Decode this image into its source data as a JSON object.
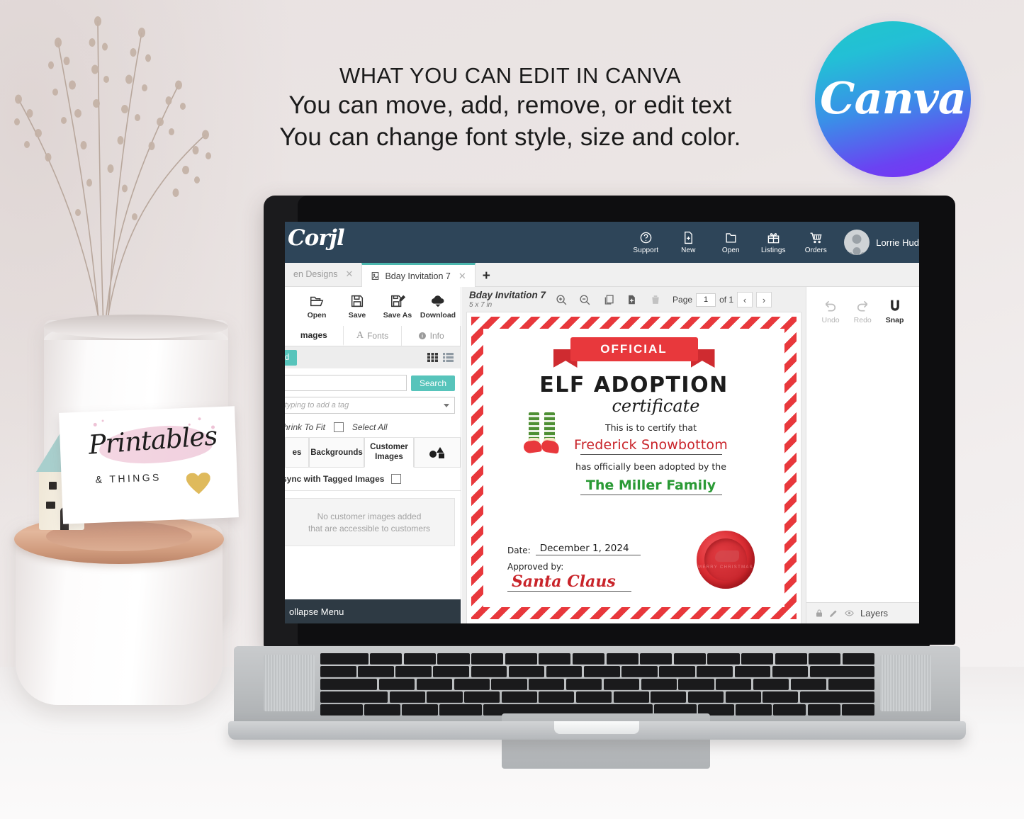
{
  "headline": {
    "line1": "WHAT YOU CAN EDIT IN CANVA",
    "line2": "You can move, add, remove, or edit text",
    "line3": "You can change font style, size and color."
  },
  "canva_badge": {
    "label": "Canva",
    "gradient_from": "#20c7c9",
    "gradient_to": "#7d2ff5"
  },
  "shop_card": {
    "title": "Printables",
    "subtitle": "& THINGS",
    "heart_color": "#dcb34a",
    "blob_color": "#f2cfdd"
  },
  "app": {
    "brand": "Corjl",
    "topbar_color": "#2e4559",
    "accent_color": "#57c4bb",
    "topnav": [
      {
        "label": "Support",
        "icon": "question-circle-icon"
      },
      {
        "label": "New",
        "icon": "new-file-icon"
      },
      {
        "label": "Open",
        "icon": "folder-icon"
      },
      {
        "label": "Listings",
        "icon": "gift-icon"
      },
      {
        "label": "Orders",
        "icon": "cart-icon"
      }
    ],
    "user": {
      "name": "Lorrie Hud"
    },
    "tabs": [
      {
        "label": "en Designs",
        "active": false,
        "closable": true
      },
      {
        "label": "Bday Invitation 7",
        "active": true,
        "closable": true
      }
    ],
    "new_tab_label": "+",
    "left_panel": {
      "tools": [
        {
          "label": "Open",
          "icon": "folder-open-icon"
        },
        {
          "label": "Save",
          "icon": "floppy-disk-icon"
        },
        {
          "label": "Save As",
          "icon": "floppy-disk-pencil-icon"
        },
        {
          "label": "Download",
          "icon": "cloud-download-icon"
        }
      ],
      "tabs": [
        {
          "label": "mages",
          "active": true
        },
        {
          "label": "Fonts",
          "icon": "letter-a-icon",
          "active": false
        },
        {
          "label": "Info",
          "icon": "info-circle-icon",
          "active": false
        }
      ],
      "upload_button": "oad",
      "view_grid_icon": "grid-view-icon",
      "view_list_icon": "list-view-icon",
      "search_value": "",
      "search_placeholder": "",
      "search_button": "Search",
      "tag_placeholder": "gin typing to add a tag",
      "shrink_to_fit_label": "Shrink To Fit",
      "select_all_label": "Select All",
      "category_tabs": [
        {
          "label": "es",
          "active": false
        },
        {
          "label": "Backgrounds",
          "active": false
        },
        {
          "label": "Customer Images",
          "active": true
        },
        {
          "label": "shapes-icon",
          "active": false
        }
      ],
      "sync_label": "-sync with Tagged Images",
      "empty_line1": "No customer images added",
      "empty_line2": "that are accessible to customers",
      "collapse_label": "ollapse Menu"
    },
    "canvas": {
      "doc_title": "Bday Invitation 7",
      "doc_size": "5 x 7 in",
      "tools": [
        {
          "icon": "zoom-in-icon",
          "name": "zoom-in"
        },
        {
          "icon": "zoom-out-icon",
          "name": "zoom-out"
        },
        {
          "icon": "duplicate-icon",
          "name": "duplicate-page"
        },
        {
          "icon": "add-page-icon",
          "name": "add-page"
        },
        {
          "icon": "trash-icon",
          "name": "delete-page"
        }
      ],
      "page_label": "Page",
      "page_value": "1",
      "page_of": "of 1",
      "prev_label": "‹",
      "next_label": "›"
    },
    "right_panel": {
      "tools": [
        {
          "label": "Undo",
          "icon": "undo-icon",
          "enabled": false
        },
        {
          "label": "Redo",
          "icon": "redo-icon",
          "enabled": false
        },
        {
          "label": "Snap",
          "icon": "magnet-icon",
          "enabled": true
        }
      ],
      "layers_label": "Layers",
      "layer_icons": [
        "lock-icon",
        "pencil-icon",
        "eye-icon"
      ]
    }
  },
  "certificate": {
    "ribbon": "OFFICIAL",
    "title": "ELF ADOPTION",
    "subtitle": "certificate",
    "intro": "This is to certify that",
    "child_name": "Frederick Snowbottom",
    "adopted_line": "has officially been adopted by the",
    "family_name": "The Miller Family",
    "date_label": "Date:",
    "date_value": "December 1, 2024",
    "approved_label": "Approved by:",
    "signature": "Santa Claus",
    "seal_text": "MERRY CHRISTMAS",
    "colors": {
      "red": "#e8383c",
      "name_red": "#c9242a",
      "green": "#2a9a35"
    }
  }
}
